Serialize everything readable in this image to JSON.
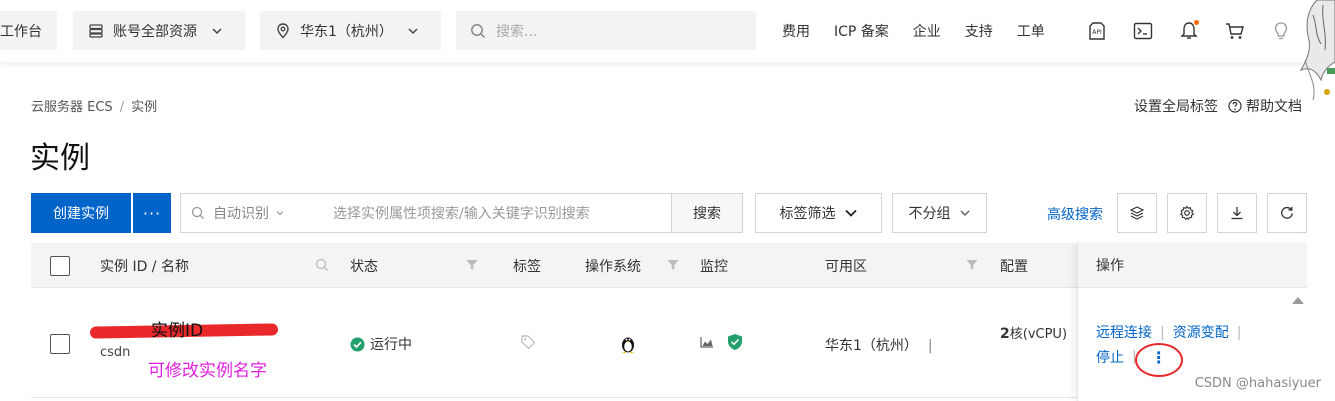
{
  "topbar": {
    "workbench": "工作台",
    "account_resources": "账号全部资源",
    "region": "华东1（杭州）",
    "search_placeholder": "搜索...",
    "links": [
      "费用",
      "ICP 备案",
      "企业",
      "支持",
      "工单"
    ]
  },
  "breadcrumb": {
    "items": [
      "云服务器 ECS",
      "实例"
    ]
  },
  "header_links": {
    "global_tags": "设置全局标签",
    "help_docs": "帮助文档"
  },
  "page_title": "实例",
  "toolbar": {
    "create_instance": "创建实例",
    "more": "···",
    "auto_detect": "自动识别",
    "search_placeholder": "选择实例属性项搜索/输入关键字识别搜索",
    "search_button": "搜索",
    "tag_filter": "标签筛选",
    "group": "不分组",
    "advanced_search": "高级搜索"
  },
  "table": {
    "headers": {
      "instance_id_name": "实例 ID / 名称",
      "status": "状态",
      "tags": "标签",
      "os": "操作系统",
      "monitor": "监控",
      "zone": "可用区",
      "config": "配置",
      "actions": "操作"
    },
    "rows": [
      {
        "name": "csdn",
        "status": "运行中",
        "zone": "华东1（杭州）",
        "config_cores": "2",
        "config_unit": "核(vCPU)",
        "actions": {
          "remote_connect": "远程连接",
          "resource_change": "资源变配",
          "stop": "停止",
          "more": "⋮"
        }
      }
    ]
  },
  "annotations": {
    "instance_id": "实例ID",
    "rename_hint": "可修改实例名字"
  },
  "watermark": "CSDN @hahasiyuer",
  "colors": {
    "primary": "#0064c8",
    "running": "#22a06b",
    "annotation_red": "#e8282b",
    "annotation_magenta": "#e020e0"
  }
}
